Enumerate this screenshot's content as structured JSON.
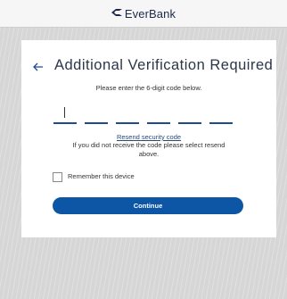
{
  "header": {
    "brand_name": "EverBank",
    "logo_icon": "everbank-logo-icon"
  },
  "card": {
    "back_icon": "arrow-left-icon",
    "title": "Additional Verification Required",
    "instructions": "Please enter the 6-digit code below.",
    "code_inputs": [
      "",
      "",
      "",
      "",
      "",
      ""
    ],
    "resend_link": "Resend security code",
    "resend_note": "If you did not receive the code please select resend above.",
    "remember_label": "Remember this device",
    "remember_checked": false,
    "continue_label": "Continue"
  },
  "colors": {
    "primary": "#0d56a6",
    "title_text": "#2b3649",
    "input_underline": "#1d4d8f",
    "link": "#2a4a7a"
  }
}
